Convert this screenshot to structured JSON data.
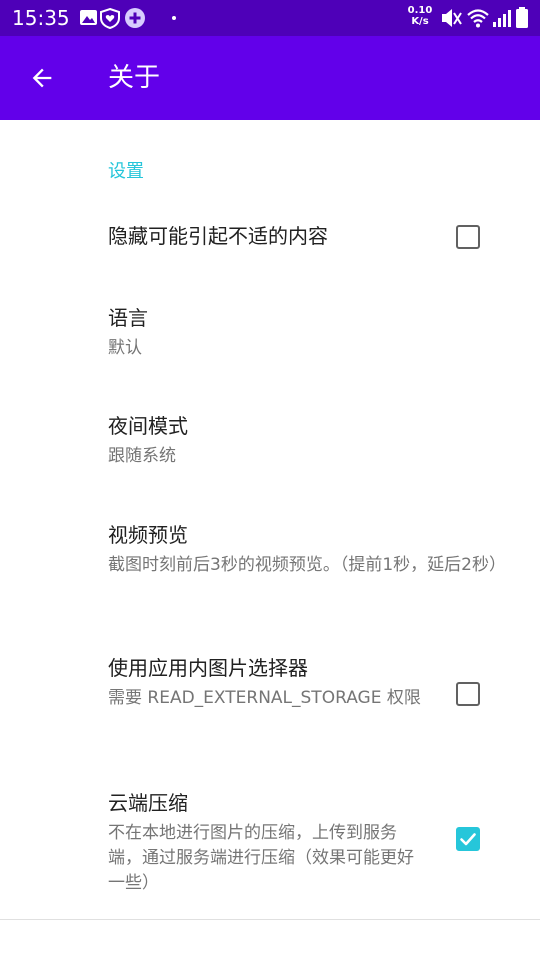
{
  "status_bar": {
    "time": "15:35",
    "net_speed_value": "0.10",
    "net_speed_unit": "K/s",
    "background": "#4e00b8",
    "left_icons": [
      "gallery-icon",
      "shield-heart-icon",
      "plus-circle-icon",
      "dot-icon"
    ],
    "right_icons": [
      "mute-icon",
      "wifi-icon",
      "signal-icon",
      "battery-icon"
    ]
  },
  "app_bar": {
    "title": "关于",
    "background": "#6200ea",
    "back_icon": "arrow-left-icon"
  },
  "settings": {
    "section_title": "设置",
    "accent": "#26c6da",
    "items": [
      {
        "title": "隐藏可能引起不适的内容",
        "checkbox": true,
        "checked": false
      },
      {
        "title": "语言",
        "summary": "默认"
      },
      {
        "title": "夜间模式",
        "summary": "跟随系统"
      },
      {
        "title": "视频预览",
        "summary": "截图时刻前后3秒的视频预览。（提前1秒，延后2秒）"
      },
      {
        "title": "使用应用内图片选择器",
        "summary": "需要 READ_EXTERNAL_STORAGE 权限",
        "checkbox": true,
        "checked": false
      },
      {
        "title": "云端压缩",
        "summary": "不在本地进行图片的压缩，上传到服务端，通过服务端进行压缩（效果可能更好一些）",
        "checkbox": true,
        "checked": true
      }
    ]
  }
}
